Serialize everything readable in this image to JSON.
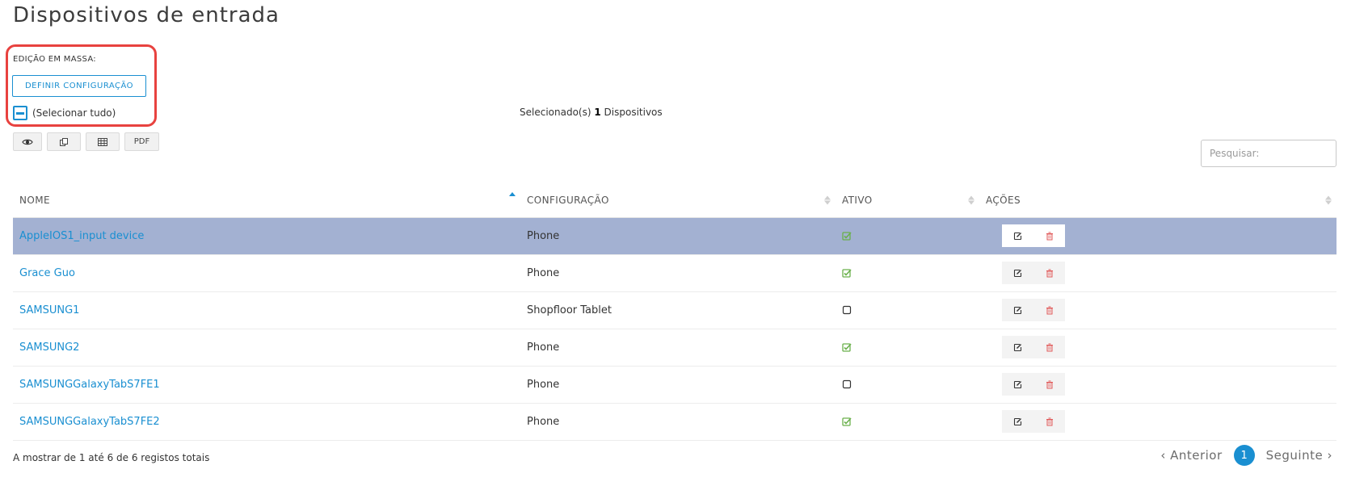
{
  "page": {
    "title": "Dispositivos de entrada"
  },
  "bulk_edit": {
    "label": "EDIÇÃO EM MASSA:",
    "define_button": "DEFINIR CONFIGURAÇÃO",
    "select_all_label": "(Selecionar tudo)"
  },
  "selection": {
    "prefix": "Selecionado(s)",
    "count": "1",
    "suffix": "Dispositivos"
  },
  "toolbar": {
    "view_icon": "eye-icon",
    "copy_icon": "copy-icon",
    "excel_icon": "table-icon",
    "pdf_label": "PDF"
  },
  "search": {
    "placeholder": "Pesquisar:",
    "value": ""
  },
  "table": {
    "columns": [
      "NOME",
      "CONFIGURAÇÃO",
      "ATIVO",
      "AÇÕES"
    ],
    "sort": {
      "column": "NOME",
      "direction": "asc"
    },
    "rows": [
      {
        "name": "AppleIOS1_input device",
        "config": "Phone",
        "active": true,
        "selected": true
      },
      {
        "name": "Grace Guo",
        "config": "Phone",
        "active": true,
        "selected": false
      },
      {
        "name": "SAMSUNG1",
        "config": "Shopfloor Tablet",
        "active": false,
        "selected": false
      },
      {
        "name": "SAMSUNG2",
        "config": "Phone",
        "active": true,
        "selected": false
      },
      {
        "name": "SAMSUNGGalaxyTabS7FE1",
        "config": "Phone",
        "active": false,
        "selected": false
      },
      {
        "name": "SAMSUNGGalaxyTabS7FE2",
        "config": "Phone",
        "active": true,
        "selected": false
      }
    ],
    "row_actions": {
      "edit_icon": "edit-icon",
      "delete_icon": "trash-icon"
    }
  },
  "footer": {
    "info": "A mostrar de 1 até 6 de 6 registos totais",
    "prev": "Anterior",
    "next": "Seguinte",
    "current_page": "1"
  },
  "colors": {
    "accent": "#1a8fd1",
    "selected_row": "#a3b1d2",
    "highlight_border": "#e8423f",
    "check_green": "#6ab04c",
    "delete_red": "#e05a5a"
  }
}
